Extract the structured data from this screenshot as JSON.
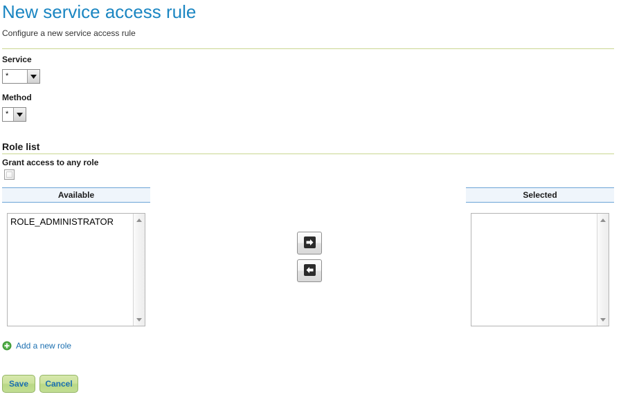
{
  "header": {
    "title": "New service access rule",
    "subtitle": "Configure a new service access rule",
    "title_color": "#1b86c2",
    "rule_color": "#c9d68f"
  },
  "form": {
    "service": {
      "label": "Service",
      "value": "*",
      "arrow_icon": "chevron-down-icon"
    },
    "method": {
      "label": "Method",
      "value": "*",
      "arrow_icon": "chevron-down-icon"
    }
  },
  "role_list": {
    "section_label": "Role list",
    "grant_label": "Grant access to any role",
    "grant_checked": false,
    "available": {
      "header": "Available",
      "options": [
        "ROLE_ADMINISTRATOR"
      ]
    },
    "selected": {
      "header": "Selected",
      "options": []
    },
    "transfer": {
      "add_icon": "arrow-right-icon",
      "remove_icon": "arrow-left-icon"
    },
    "scrollbar": {
      "up_icon": "triangle-up-icon",
      "down_icon": "triangle-down-icon"
    },
    "add_role": {
      "icon": "plus-circle-icon",
      "label": "Add a new role",
      "icon_color": "#46a040",
      "link_color": "#1b6fb0"
    },
    "panel_header_bg": "#eff5fb",
    "panel_header_border": "#6ba3d6"
  },
  "footer": {
    "save_label": "Save",
    "cancel_label": "Cancel",
    "button_bg": "#c6e09a",
    "button_text_color": "#1b6fb0"
  }
}
